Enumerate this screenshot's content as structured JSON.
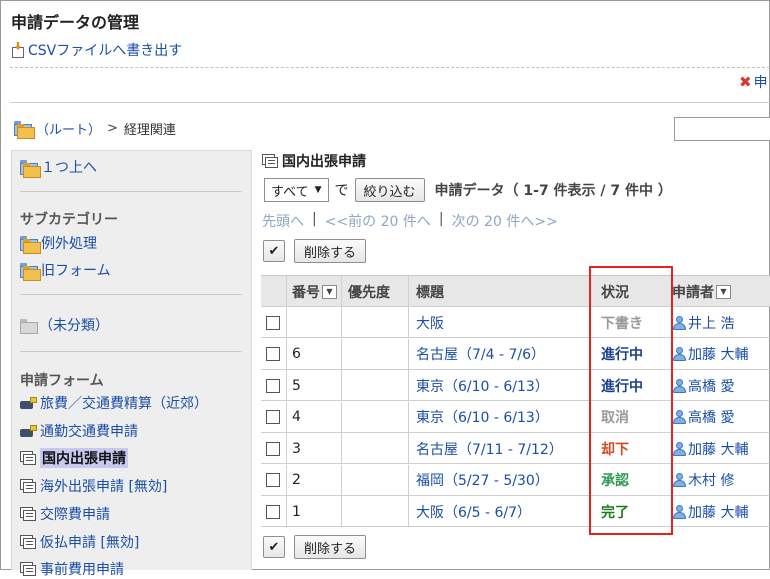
{
  "page": {
    "title": "申請データの管理",
    "csv_export": "CSVファイルへ書き出す",
    "top_right_action": "申"
  },
  "breadcrumb": {
    "root": "（ルート）",
    "separator": ">",
    "current": "経理関連"
  },
  "sidebar": {
    "up": "１つ上へ",
    "subcategory_heading": "サブカテゴリー",
    "subcategories": [
      "例外処理",
      "旧フォーム"
    ],
    "uncategorized": "（未分類）",
    "forms_heading": "申請フォーム",
    "forms": [
      {
        "label": "旅費／交通費精算（近郊）",
        "icon": "travel-icon"
      },
      {
        "label": "通勤交通費申請",
        "icon": "travel-icon"
      },
      {
        "label": "国内出張申請",
        "icon": "form-icon",
        "active": true
      },
      {
        "label": "海外出張申請 [無効]",
        "icon": "form-icon"
      },
      {
        "label": "交際費申請",
        "icon": "form-icon"
      },
      {
        "label": "仮払申請 [無効]",
        "icon": "form-icon"
      },
      {
        "label": "事前費用申請",
        "icon": "form-icon"
      }
    ]
  },
  "main": {
    "form_title": "国内出張申請",
    "filter": {
      "selected": "すべて",
      "de": "で",
      "button": "絞り込む",
      "summary": "申請データ（ 1-7 件表示 / 7 件中 ）"
    },
    "pager": {
      "first": "先頭へ",
      "prev": "<<前の 20 件へ",
      "next": "次の 20 件へ>>",
      "sep": "|"
    },
    "bulk": {
      "check_all": "✔",
      "delete": "削除する"
    },
    "table": {
      "headers": {
        "number": "番号",
        "priority": "優先度",
        "subject": "標題",
        "status": "状況",
        "applicant": "申請者"
      },
      "rows": [
        {
          "number": "",
          "priority": "",
          "subject": "大阪",
          "status": "下書き",
          "status_color": "#9a9a9a",
          "applicant": "井上 浩"
        },
        {
          "number": "6",
          "priority": "",
          "subject": "名古屋（7/4 - 7/6）",
          "status": "進行中",
          "status_color": "#1b3f8f",
          "applicant": "加藤 大輔"
        },
        {
          "number": "5",
          "priority": "",
          "subject": "東京（6/10 - 6/13）",
          "status": "進行中",
          "status_color": "#1b3f8f",
          "applicant": "高橋 愛"
        },
        {
          "number": "4",
          "priority": "",
          "subject": "東京（6/10 - 6/13）",
          "status": "取消",
          "status_color": "#9a9a9a",
          "applicant": "高橋 愛"
        },
        {
          "number": "3",
          "priority": "",
          "subject": "名古屋（7/11 - 7/12）",
          "status": "却下",
          "status_color": "#d4481c",
          "applicant": "加藤 大輔"
        },
        {
          "number": "2",
          "priority": "",
          "subject": "福岡（5/27 - 5/30）",
          "status": "承認",
          "status_color": "#2f9a54",
          "applicant": "木村 修"
        },
        {
          "number": "1",
          "priority": "",
          "subject": "大阪（6/5 - 6/7）",
          "status": "完了",
          "status_color": "#1f7a1f",
          "applicant": "加藤 大輔"
        }
      ]
    }
  },
  "colors": {
    "link": "#1a4ea8",
    "highlight_box": "#e52222",
    "active_sidebar": "#c8c8f0"
  }
}
